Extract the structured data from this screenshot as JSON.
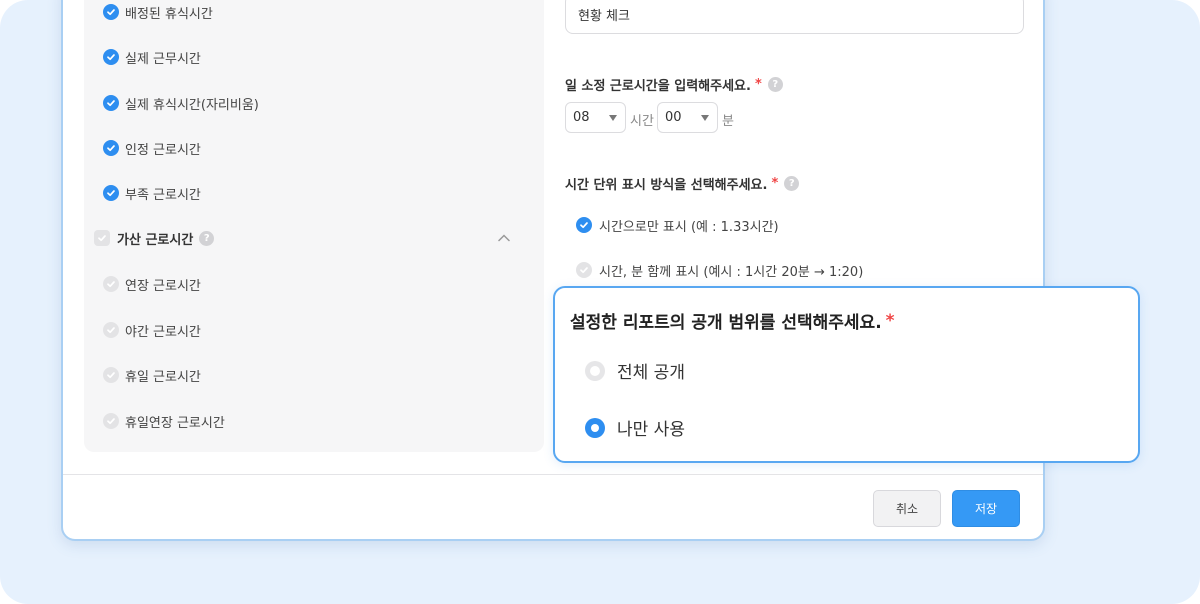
{
  "left_list": {
    "items": [
      {
        "label": "배정된 휴식시간",
        "checked": true
      },
      {
        "label": "실제 근무시간",
        "checked": true
      },
      {
        "label": "실제 휴식시간(자리비움)",
        "checked": true
      },
      {
        "label": "인정 근로시간",
        "checked": true
      },
      {
        "label": "부족 근로시간",
        "checked": true
      }
    ],
    "group": {
      "label": "가산 근로시간",
      "help_icon": "question-icon",
      "expanded": true
    },
    "sub_items": [
      {
        "label": "연장 근로시간",
        "checked": false
      },
      {
        "label": "야간 근로시간",
        "checked": false
      },
      {
        "label": "휴일 근로시간",
        "checked": false
      },
      {
        "label": "휴일연장 근로시간",
        "checked": false
      }
    ]
  },
  "right": {
    "name_input_value": "현황 체크",
    "daily_hours_label": "일 소정 근로시간을 입력해주세요.",
    "hours_select": "08",
    "hours_unit": "시간",
    "minutes_select": "00",
    "minutes_unit": "분",
    "display_label": "시간 단위 표시 방식을 선택해주세요.",
    "display_options": [
      {
        "label": "시간으로만 표시 (예 : 1.33시간)",
        "checked": true
      },
      {
        "label": "시간, 분 함께 표시 (예시 : 1시간 20분 → 1:20)",
        "checked": false
      }
    ],
    "required_mark": "*"
  },
  "footer": {
    "cancel_label": "취소",
    "save_label": "저장"
  },
  "popup": {
    "title": "설정한 리포트의 공개 범위를 선택해주세요.",
    "required_mark": "*",
    "options": [
      {
        "label": "전체 공개",
        "selected": false
      },
      {
        "label": "나만 사용",
        "selected": true
      }
    ]
  },
  "colors": {
    "accent": "#2e8ef0",
    "background": "#e6f1fd",
    "required": "#f04545"
  }
}
